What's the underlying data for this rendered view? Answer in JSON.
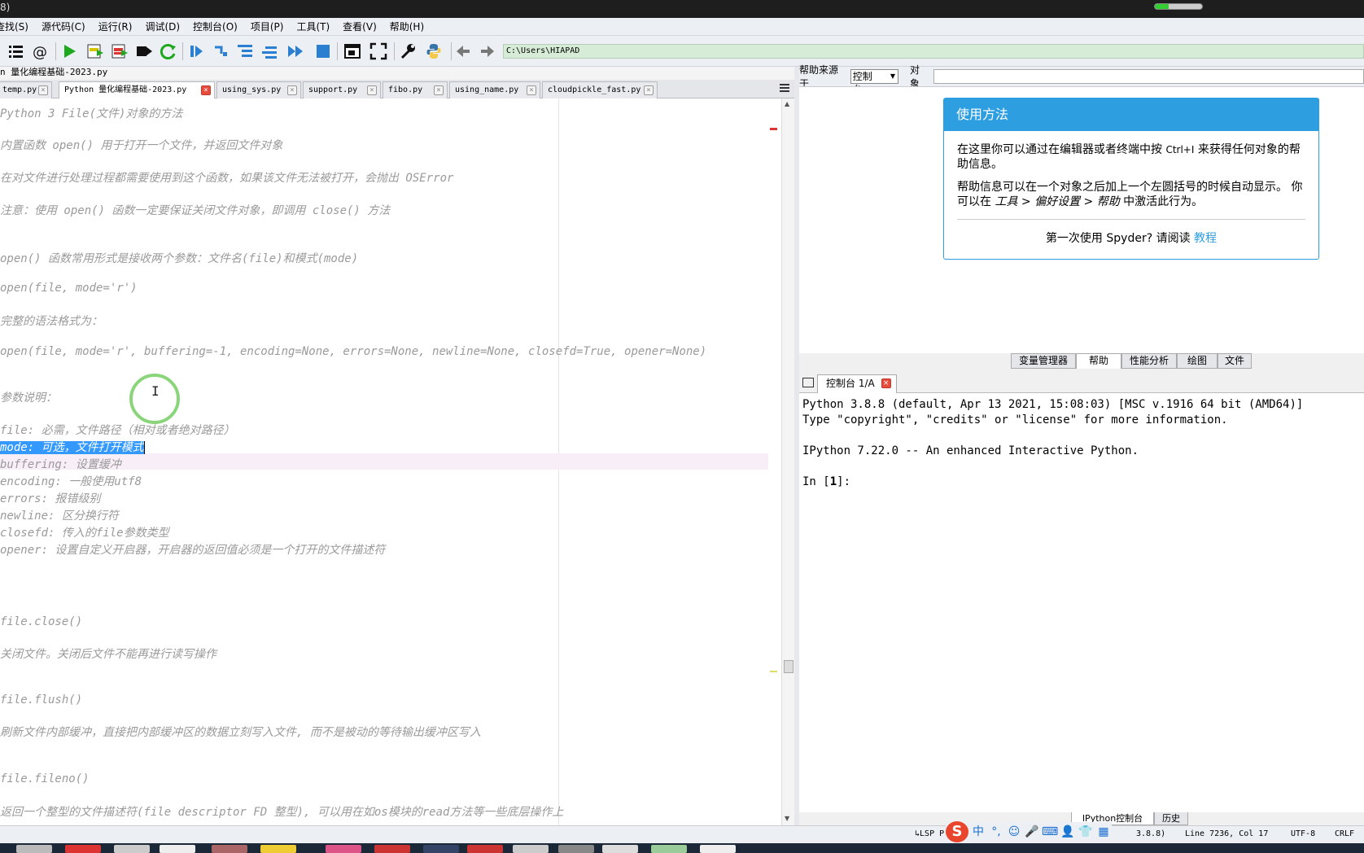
{
  "window": {
    "title_fragment": "8)",
    "progress": 0.3
  },
  "menu": [
    "查找(S)",
    "源代码(C)",
    "运行(R)",
    "调试(D)",
    "控制台(O)",
    "项目(P)",
    "工具(T)",
    "查看(V)",
    "帮助(H)"
  ],
  "toolbar": {
    "icons": [
      "outline-icon",
      "at-icon",
      "run-icon",
      "run-cell-icon",
      "run-cell-advance-icon",
      "run-selection-icon",
      "rerun-icon",
      "debug-icon",
      "step-icon",
      "step-into-icon",
      "step-return-icon",
      "continue-icon",
      "stop-icon",
      "maximize-pane-icon",
      "fullscreen-icon",
      "preferences-icon",
      "python-path-icon",
      "back-icon",
      "forward-icon"
    ],
    "path": "C:\\Users\\HIAPAD"
  },
  "editor": {
    "file_title": "n 量化编程基础-2023.py",
    "tabs": [
      {
        "label": "temp.py",
        "active": false
      },
      {
        "label": "Python 量化编程基础-2023.py",
        "active": true
      },
      {
        "label": "using_sys.py",
        "active": false
      },
      {
        "label": "support.py",
        "active": false
      },
      {
        "label": "fibo.py",
        "active": false
      },
      {
        "label": "using_name.py",
        "active": false
      },
      {
        "label": "cloudpickle_fast.py",
        "active": false
      }
    ],
    "lines": [
      "Python 3  File(文件)对象的方法",
      "内置函数 open() 用于打开一个文件，并返回文件对象",
      "在对文件进行处理过程都需要使用到这个函数，如果该文件无法被打开，会抛出 OSError",
      "注意：使用 open() 函数一定要保证关闭文件对象，即调用 close() 方法",
      "open() 函数常用形式是接收两个参数：文件名(file)和模式(mode)",
      "open(file, mode='r')",
      "完整的语法格式为：",
      "open(file, mode='r', buffering=-1, encoding=None, errors=None, newline=None, closefd=True, opener=None)",
      "参数说明：",
      "file: 必需，文件路径（相对或者绝对路径）",
      "mode: 可选，文件打开模式",
      "buffering: 设置缓冲",
      "encoding: 一般使用utf8",
      "errors: 报错级别",
      "newline: 区分换行符",
      "closefd: 传入的file参数类型",
      "opener: 设置自定义开启器，开启器的返回值必须是一个打开的文件描述符",
      "file.close()",
      "关闭文件。关闭后文件不能再进行读写操作",
      "file.flush()",
      "刷新文件内部缓冲，直接把内部缓冲区的数据立刻写入文件, 而不是被动的等待输出缓冲区写入",
      "file.fileno()",
      "返回一个整型的文件描述符(file descriptor FD 整型), 可以用在如os模块的read方法等一些底层操作上"
    ],
    "selected_line_index": 10
  },
  "help": {
    "source_label": "帮助来源于",
    "source_value": "控制台",
    "object_label": "对象",
    "card_title": "使用方法",
    "para1_a": "在这里你可以通过在编辑器或者终端中按 ",
    "para1_key": "Ctrl+I",
    "para1_b": " 来获得任何对象的帮助信息。",
    "para2_a": "帮助信息可以在一个对象之后加上一个左圆括号的时候自动显示。 你可以在 ",
    "para2_path": "工具 > 偏好设置 > 帮助",
    "para2_b": " 中激活此行为。",
    "footer_text": "第一次使用 Spyder? 请阅读 ",
    "footer_link": "教程"
  },
  "pane_tabs": [
    "变量管理器",
    "帮助",
    "性能分析",
    "绘图",
    "文件"
  ],
  "active_pane_tab": "帮助",
  "console": {
    "tab_label": "控制台 1/A",
    "lines": [
      "Python 3.8.8 (default, Apr 13 2021, 15:08:03) [MSC v.1916 64 bit (AMD64)]",
      "Type \"copyright\", \"credits\" or \"license\" for more information.",
      "",
      "IPython 7.22.0 -- An enhanced Interactive Python.",
      "",
      "In [1]:"
    ],
    "bottom_tabs": [
      "IPython控制台",
      "历史"
    ]
  },
  "status": {
    "lsp": "LSP P",
    "ime_logo": "S",
    "ime_mode": "中",
    "ime_glyphs": [
      "°,",
      "☺",
      "🎤",
      "⌨",
      "👤",
      "👕",
      "▦"
    ],
    "python_version": "3.8.8)",
    "position": "Line 7236, Col 17",
    "encoding": "UTF-8",
    "eol": "CRLF"
  },
  "colors": {
    "accent": "#2d9ee0",
    "selection": "#3399ff",
    "comment": "#9a9a9a",
    "close_red": "#e84c3d",
    "path_bg": "#d7ecd7"
  }
}
